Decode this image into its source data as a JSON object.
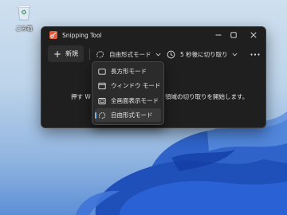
{
  "desktop": {
    "recycle_bin_label": "ごみ箱",
    "icon": "recycle-bin-icon"
  },
  "window": {
    "title": "Snipping Tool",
    "app_icon": "snipping-tool-icon",
    "controls": [
      "minimize-icon",
      "maximize-icon",
      "close-icon"
    ]
  },
  "toolbar": {
    "new_label": "新規",
    "new_icon": "plus-icon",
    "mode_label": "自由形式モード",
    "mode_icon": "freeform-snip-icon",
    "delay_label": "5 秒後に切り取り",
    "delay_icon": "timer-icon",
    "more_icon": "more-dots-icon"
  },
  "hint": {
    "part1": "押す W",
    "part2": "領域の切り取りを開始します。"
  },
  "mode_menu": {
    "items": [
      {
        "label": "長方形モード",
        "icon": "rectangle-snip-icon",
        "selected": false
      },
      {
        "label": "ウィンドウ モード",
        "icon": "window-snip-icon",
        "selected": false
      },
      {
        "label": "全画面表示モード",
        "icon": "fullscreen-snip-icon",
        "selected": false
      },
      {
        "label": "自由形式モード",
        "icon": "freeform-snip-icon",
        "selected": true
      }
    ]
  },
  "colors": {
    "window_bg": "#1f1f1f",
    "menu_bg": "#2b2b2b",
    "accent": "#76b9ed",
    "text": "#eaeaea"
  }
}
